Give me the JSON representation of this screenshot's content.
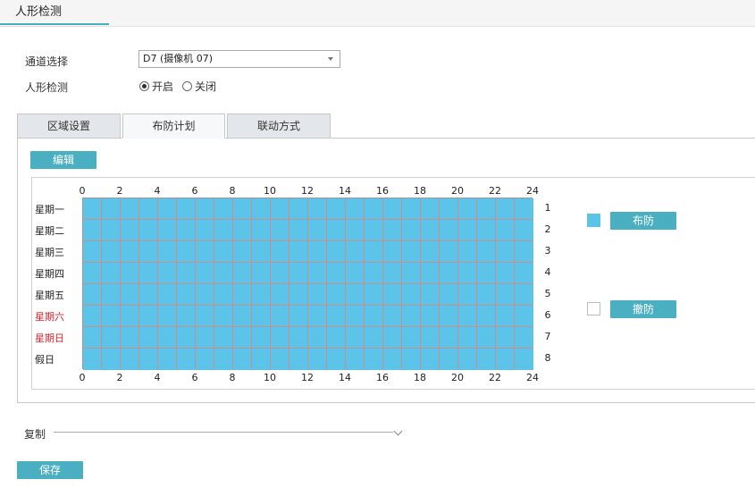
{
  "header": {
    "title": "人形检测"
  },
  "form": {
    "channel_label": "通道选择",
    "channel_value": "D7 (摄像机 07)",
    "detect_label": "人形检测",
    "radio_on": "开启",
    "radio_off": "关闭",
    "selected": "on"
  },
  "tabs": [
    {
      "label": "区域设置",
      "active": false
    },
    {
      "label": "布防计划",
      "active": true
    },
    {
      "label": "联动方式",
      "active": false
    }
  ],
  "schedule": {
    "edit_label": "编辑",
    "hour_ticks": [
      "0",
      "2",
      "4",
      "6",
      "8",
      "10",
      "12",
      "14",
      "16",
      "18",
      "20",
      "22",
      "24"
    ],
    "days": [
      "星期一",
      "星期二",
      "星期三",
      "星期四",
      "星期五",
      "星期六",
      "星期日",
      "假日"
    ],
    "day_colors": [
      "#222222",
      "#222222",
      "#222222",
      "#222222",
      "#222222",
      "#d9232d",
      "#d9232d",
      "#222222"
    ],
    "row_numbers": [
      "1",
      "2",
      "3",
      "4",
      "5",
      "6",
      "7",
      "8"
    ],
    "hours": 24,
    "armed_color": "#5bc4e8",
    "cell_border_color": "#c98f8f",
    "armed_fraction": 1.0
  },
  "legend": {
    "arm_label": "布防",
    "disarm_label": "撤防",
    "arm_color": "#5bc4e8"
  },
  "copy": {
    "label": "复制"
  },
  "footer": {
    "save_label": "保存"
  }
}
